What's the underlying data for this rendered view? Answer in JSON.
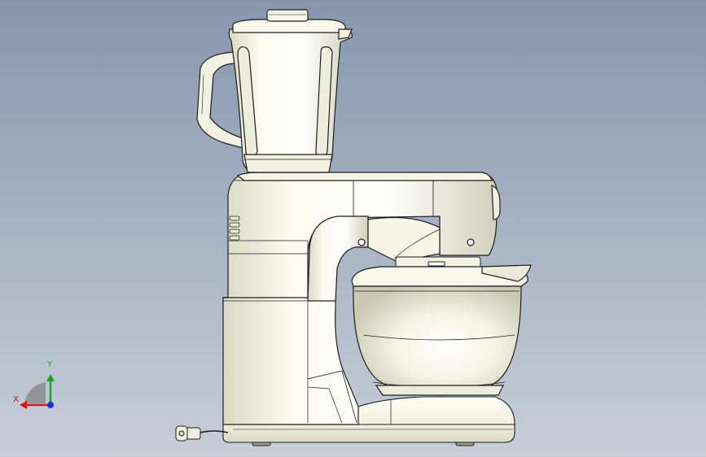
{
  "view": {
    "background_top": "#8796ae",
    "background_bottom": "#c7ced8",
    "model_fill": "#fafaee",
    "model_shade": "#e2e2cf",
    "edge_color": "#1e1e1e"
  },
  "triad": {
    "x_label": "X",
    "y_label": "Y",
    "x_color": "#d31818",
    "y_color": "#1da51d",
    "z_color": "#1530d8"
  }
}
